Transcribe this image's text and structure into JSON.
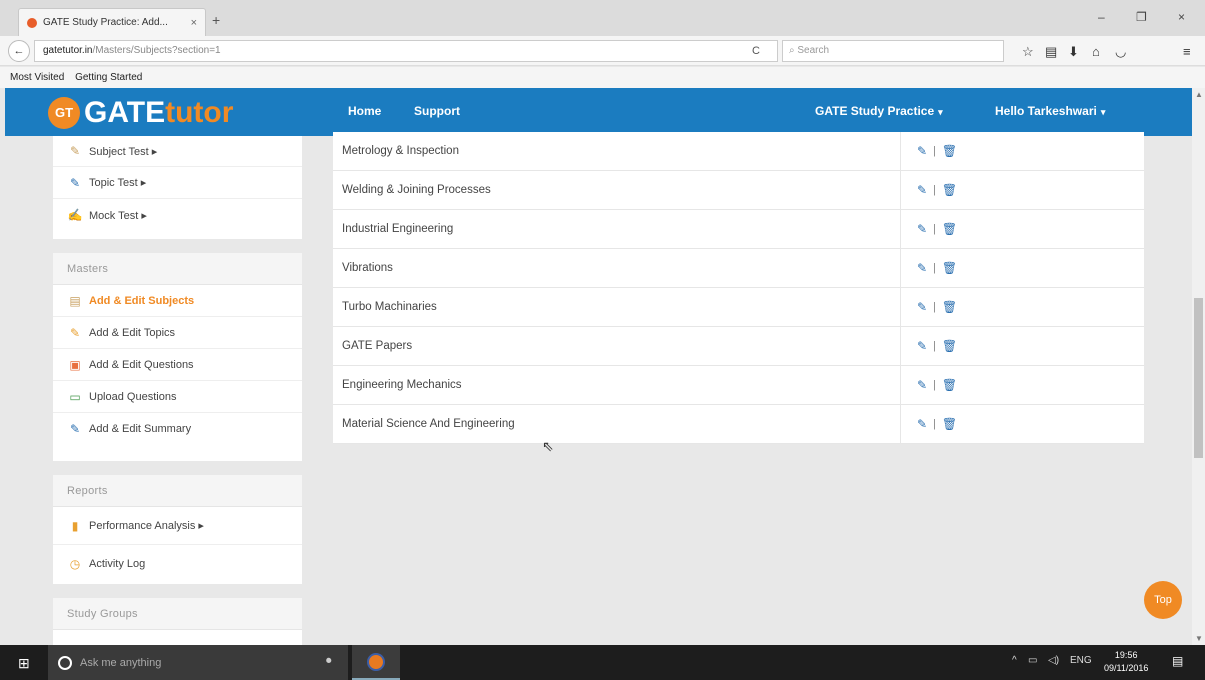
{
  "browser": {
    "tab_title": "GATE Study Practice: Add...",
    "tab_close": "×",
    "new_tab": "+",
    "win_min": "–",
    "win_max": "❐",
    "win_close": "×",
    "back": "←",
    "url_host": "gatetutor.in",
    "url_path": "/Masters/Subjects?section=1",
    "reload": "C",
    "search_placeholder": "Search",
    "bookmarks": [
      "Most Visited",
      "Getting Started"
    ]
  },
  "header": {
    "logo_badge": "GT",
    "logo_gate": "GATE",
    "logo_tutor": "tutor",
    "nav_home": "Home",
    "nav_support": "Support",
    "nav_practice": "GATE Study Practice",
    "nav_user": "Hello Tarkeshwari"
  },
  "sidebar": {
    "tests": [
      {
        "label": "Subject Test ▸",
        "icon": "✎"
      },
      {
        "label": "Topic Test ▸",
        "icon": "✎"
      },
      {
        "label": "Mock Test ▸",
        "icon": "✍"
      }
    ],
    "masters": {
      "heading": "Masters",
      "items": [
        {
          "label": "Add & Edit Subjects",
          "icon": "▤"
        },
        {
          "label": "Add & Edit Topics",
          "icon": "✎"
        },
        {
          "label": "Add & Edit Questions",
          "icon": "▣"
        },
        {
          "label": "Upload Questions",
          "icon": "▭"
        },
        {
          "label": "Add & Edit Summary",
          "icon": "✎"
        }
      ]
    },
    "reports": {
      "heading": "Reports",
      "items": [
        {
          "label": "Performance Analysis ▸",
          "icon": "▮"
        },
        {
          "label": "Activity Log",
          "icon": "◷"
        }
      ]
    },
    "study_groups": {
      "heading": "Study Groups"
    }
  },
  "subjects": [
    "Metrology & Inspection",
    "Welding & Joining Processes",
    "Industrial Engineering",
    "Vibrations",
    "Turbo Machinaries",
    "GATE Papers",
    "Engineering Mechanics",
    "Material Science And Engineering"
  ],
  "actions": {
    "edit": "✎",
    "sep": "|",
    "delete": "🗑"
  },
  "top_button": "Top",
  "taskbar": {
    "search_placeholder": "Ask me anything",
    "lang": "ENG",
    "time": "19:56",
    "date": "09/11/2016"
  },
  "colors": {
    "brand_blue": "#1b7cc0",
    "accent_orange": "#f08a24"
  }
}
